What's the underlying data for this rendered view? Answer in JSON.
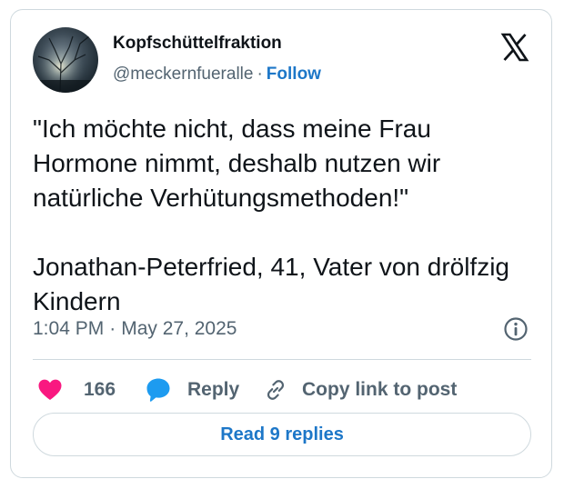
{
  "author": {
    "display_name": "Kopfschüttelfraktion",
    "handle": "@meckernfueralle",
    "separator": "·",
    "follow_label": "Follow"
  },
  "tweet": {
    "text": "\"Ich möchte nicht, dass meine Frau Hormone nimmt, deshalb nutzen wir natürliche Verhütungsmethoden!\"\n\nJonathan-Peterfried, 41, Vater von drölfzig Kindern",
    "time": "1:04 PM",
    "separator": "·",
    "date": "May 27, 2025"
  },
  "actions": {
    "like_count": "166",
    "reply_label": "Reply",
    "copy_link_label": "Copy link to post"
  },
  "read_replies_label": "Read 9 replies",
  "icons": {
    "platform": "x-logo-icon",
    "info": "info-icon",
    "like": "heart-icon",
    "reply": "speech-bubble-icon",
    "copy": "link-icon"
  },
  "colors": {
    "heart": "#f91880",
    "reply_bubble": "#1d9bf0",
    "follow_link": "#1d77c8",
    "text_primary": "#0f1419",
    "text_secondary": "#536471",
    "border": "#cfd9de"
  }
}
